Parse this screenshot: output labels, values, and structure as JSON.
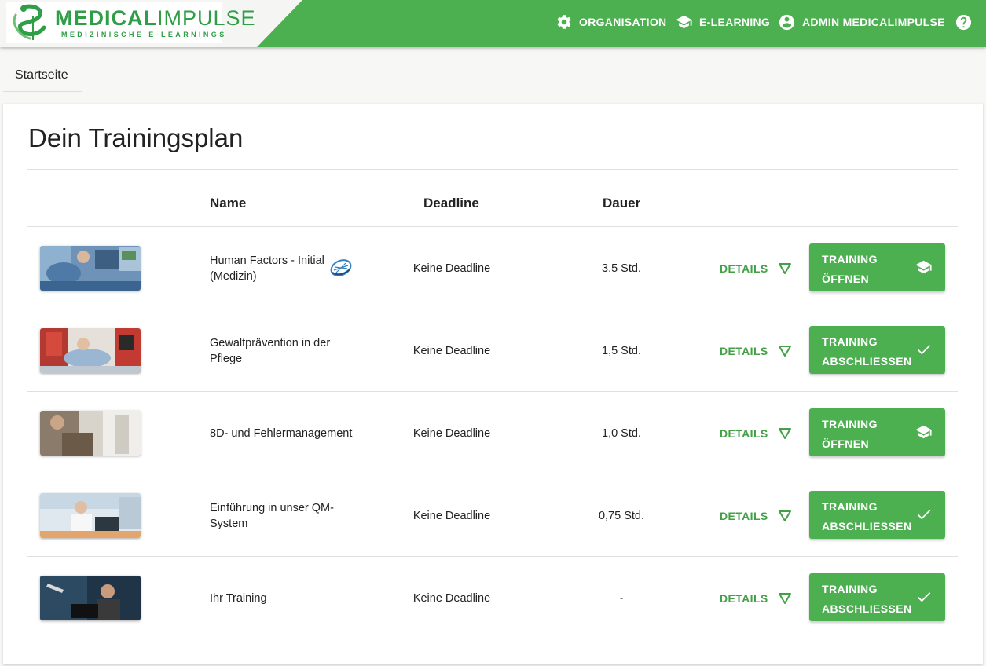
{
  "brand": {
    "name_bold": "MEDICAL",
    "name_light": "IMPULSE",
    "tagline": "MEDIZINISCHE E-LEARNINGS",
    "colors": {
      "primary": "#4caf50",
      "logo": "#2e9e47",
      "link": "#43a047"
    }
  },
  "nav": {
    "items": [
      {
        "label": "ORGANISATION",
        "icon": "gear-icon"
      },
      {
        "label": "E-LEARNING",
        "icon": "graduation-cap-icon"
      },
      {
        "label": "ADMIN MEDICALIMPULSE",
        "icon": "account-circle-icon"
      }
    ],
    "help_icon": "help-circle-icon"
  },
  "breadcrumb": {
    "label": "Startseite"
  },
  "page": {
    "title": "Dein Trainingsplan",
    "columns": {
      "name": "Name",
      "deadline": "Deadline",
      "dauer": "Dauer"
    },
    "rows": [
      {
        "name": "Human Factors - Initial (Medizin)",
        "deadline": "Keine Deadline",
        "dauer": "3,5 Std.",
        "details": "DETAILS",
        "button": "TRAINING\nÖFFNEN",
        "button_icon": "graduation-cap-icon",
        "partner_logo": true
      },
      {
        "name": "Gewaltprävention in der Pflege",
        "deadline": "Keine Deadline",
        "dauer": "1,5 Std.",
        "details": "DETAILS",
        "button": "TRAINING\nABSCHLIESSEN",
        "button_icon": "check-icon"
      },
      {
        "name": "8D- und Fehlermanagement",
        "deadline": "Keine Deadline",
        "dauer": "1,0 Std.",
        "details": "DETAILS",
        "button": "TRAINING\nÖFFNEN",
        "button_icon": "graduation-cap-icon"
      },
      {
        "name": "Einführung in unser QM-System",
        "deadline": "Keine Deadline",
        "dauer": "0,75 Std.",
        "details": "DETAILS",
        "button": "TRAINING\nABSCHLIESSEN",
        "button_icon": "check-icon"
      },
      {
        "name": "Ihr Training",
        "deadline": "Keine Deadline",
        "dauer": "-",
        "details": "DETAILS",
        "button": "TRAINING\nABSCHLIESSEN",
        "button_icon": "check-icon"
      }
    ]
  }
}
